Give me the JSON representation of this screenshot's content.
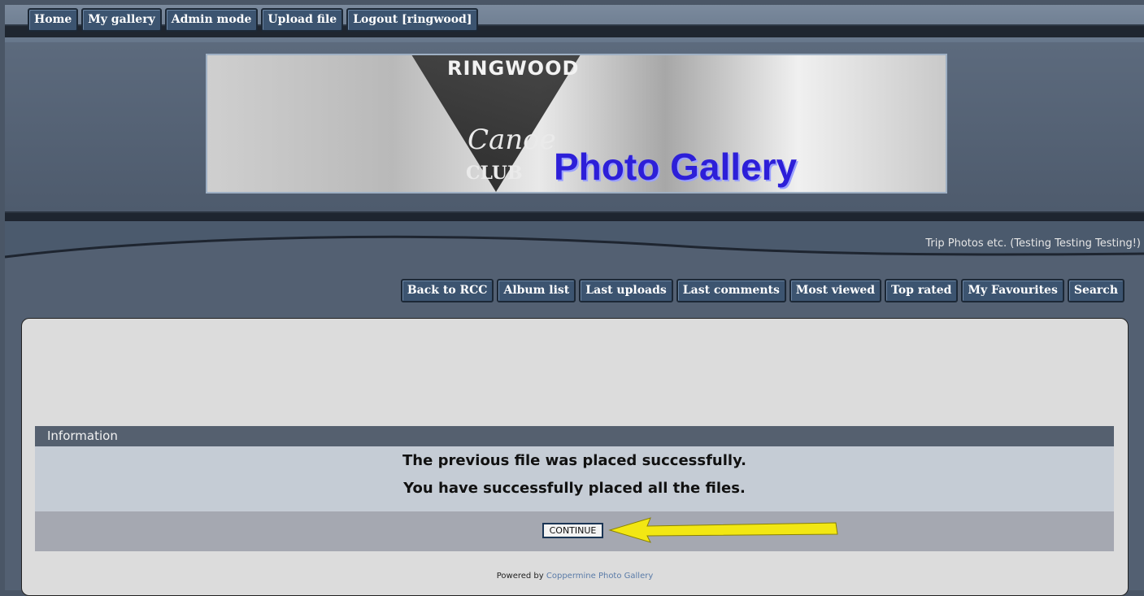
{
  "topnav": {
    "items": [
      {
        "label": "Home"
      },
      {
        "label": "My gallery"
      },
      {
        "label": "Admin mode"
      },
      {
        "label": "Upload file"
      },
      {
        "label": "Logout [ringwood]"
      }
    ]
  },
  "banner": {
    "logo_top": "RINGWOOD",
    "logo_script": "Canoe",
    "logo_bottom": "CLUB",
    "title": "Photo Gallery"
  },
  "tagline": "Trip Photos etc. (Testing Testing Testing!)",
  "subnav": {
    "items": [
      {
        "label": "Back to RCC"
      },
      {
        "label": "Album list"
      },
      {
        "label": "Last uploads"
      },
      {
        "label": "Last comments"
      },
      {
        "label": "Most viewed"
      },
      {
        "label": "Top rated"
      },
      {
        "label": "My Favourites"
      },
      {
        "label": "Search"
      }
    ]
  },
  "info": {
    "header": "Information",
    "line1": "The previous file was placed successfully.",
    "line2": "You have successfully placed all the files.",
    "continue_label": "CONTINUE"
  },
  "footer": {
    "prefix": "Powered by",
    "link": "Coppermine Photo Gallery"
  },
  "colors": {
    "nav_button_bg": "#3c5470",
    "info_header_bg": "#55606f",
    "arrow": "#f2e713"
  }
}
